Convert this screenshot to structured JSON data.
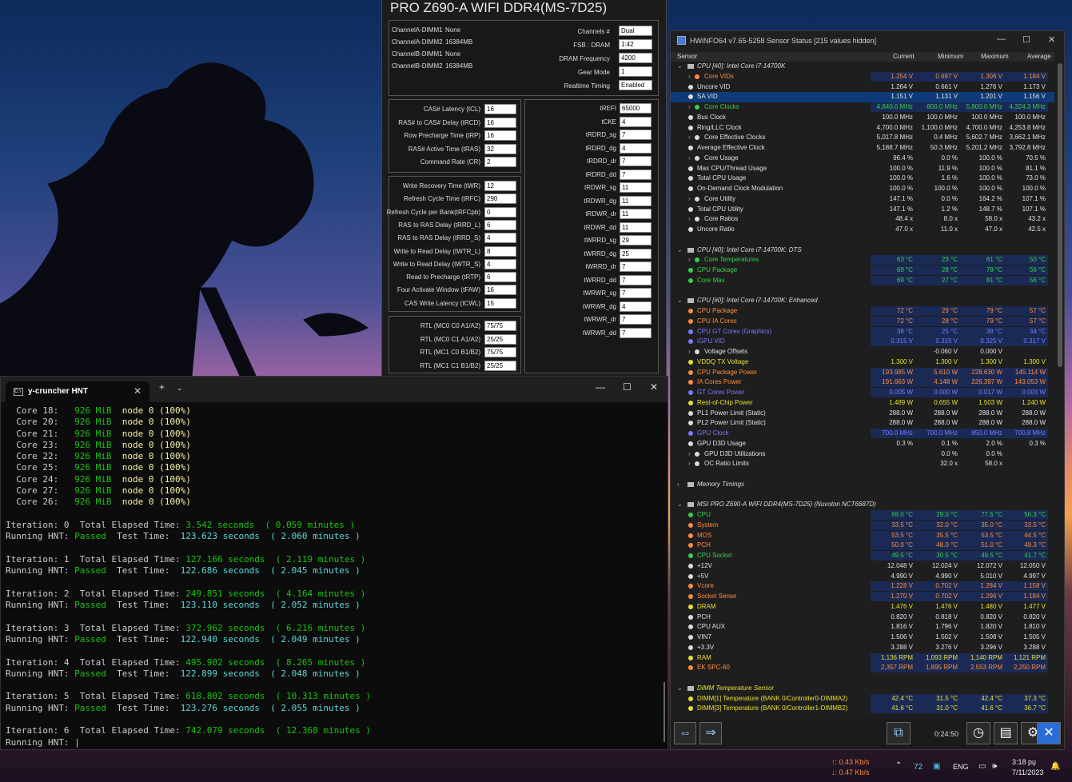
{
  "memory_panel": {
    "title": "PRO Z690-A WIFI DDR4(MS-7D25)",
    "dimms": [
      {
        "label": "ChannelA-DIMM1",
        "value": "None"
      },
      {
        "label": "ChannelA-DIMM2",
        "value": "16384MB"
      },
      {
        "label": "ChannelB-DIMM1",
        "value": "None"
      },
      {
        "label": "ChannelB-DIMM2",
        "value": "16384MB"
      }
    ],
    "summary": [
      {
        "label": "Channels #",
        "value": "Dual"
      },
      {
        "label": "FSB : DRAM",
        "value": "1:42"
      },
      {
        "label": "DRAM Frequency",
        "value": "4200"
      },
      {
        "label": "Gear Mode",
        "value": "1"
      },
      {
        "label": "Realtime Timing",
        "value": "Enabled"
      }
    ],
    "primary": [
      {
        "label": "CAS# Latency (tCL)",
        "value": "16"
      },
      {
        "label": "RAS# to CAS# Delay (tRCD)",
        "value": "16"
      },
      {
        "label": "Row Precharge Time (tRP)",
        "value": "16"
      },
      {
        "label": "RAS# Active Time (tRAS)",
        "value": "32"
      },
      {
        "label": "Command Rate (CR)",
        "value": "2"
      }
    ],
    "secondary": [
      {
        "label": "Write Recovery Time (tWR)",
        "value": "12"
      },
      {
        "label": "Refresh Cycle Time (tRFC)",
        "value": "290"
      },
      {
        "label": "Refresh Cycle per Bank(tRFCpb)",
        "value": "0"
      },
      {
        "label": "RAS to RAS Delay (tRRD_L)",
        "value": "6"
      },
      {
        "label": "RAS to RAS Delay (tRRD_S)",
        "value": "4"
      },
      {
        "label": "Write to Read Delay (tWTR_L)",
        "value": "8"
      },
      {
        "label": "Write to Read Delay (tWTR_S)",
        "value": "4"
      },
      {
        "label": "Read to Precharge (tRTP)",
        "value": "6"
      },
      {
        "label": "Four Activate Window (tFAW)",
        "value": "16"
      },
      {
        "label": "CAS Write Latency (tCWL)",
        "value": "15"
      }
    ],
    "rtl": [
      {
        "label": "RTL (MC0 C0 A1/A2)",
        "value": "75/75"
      },
      {
        "label": "RTL (MC0 C1 A1/A2)",
        "value": "25/25"
      },
      {
        "label": "RTL (MC1 C0 B1/B2)",
        "value": "75/75"
      },
      {
        "label": "RTL (MC1 C1 B1/B2)",
        "value": "25/25"
      }
    ],
    "tertiary": [
      {
        "label": "tREFI",
        "value": "65000"
      },
      {
        "label": "tCKE",
        "value": "4"
      },
      {
        "label": "tRDRD_sg",
        "value": "7"
      },
      {
        "label": "tRDRD_dg",
        "value": "4"
      },
      {
        "label": "tRDRD_dr",
        "value": "7"
      },
      {
        "label": "tRDRD_dd",
        "value": "7"
      },
      {
        "label": "tRDWR_sg",
        "value": "11"
      },
      {
        "label": "tRDWR_dg",
        "value": "11"
      },
      {
        "label": "tRDWR_dr",
        "value": "11"
      },
      {
        "label": "tRDWR_dd",
        "value": "11"
      },
      {
        "label": "tWRRD_sg",
        "value": "29"
      },
      {
        "label": "tWRRD_dg",
        "value": "25"
      },
      {
        "label": "tWRRD_dr",
        "value": "7"
      },
      {
        "label": "tWRRD_dd",
        "value": "7"
      },
      {
        "label": "tWRWR_sg",
        "value": "7"
      },
      {
        "label": "tWRWR_dg",
        "value": "4"
      },
      {
        "label": "tWRWR_dr",
        "value": "7"
      },
      {
        "label": "tWRWR_dd",
        "value": "7"
      }
    ]
  },
  "terminal": {
    "tab_title": "y-cruncher HNT",
    "cores": [
      {
        "core": "18",
        "mem": "926 MiB",
        "node": "node 0 (100%)"
      },
      {
        "core": "20",
        "mem": "926 MiB",
        "node": "node 0 (100%)"
      },
      {
        "core": "21",
        "mem": "926 MiB",
        "node": "node 0 (100%)"
      },
      {
        "core": "23",
        "mem": "926 MiB",
        "node": "node 0 (100%)"
      },
      {
        "core": "22",
        "mem": "926 MiB",
        "node": "node 0 (100%)"
      },
      {
        "core": "25",
        "mem": "926 MiB",
        "node": "node 0 (100%)"
      },
      {
        "core": "24",
        "mem": "926 MiB",
        "node": "node 0 (100%)"
      },
      {
        "core": "27",
        "mem": "926 MiB",
        "node": "node 0 (100%)"
      },
      {
        "core": "26",
        "mem": "926 MiB",
        "node": "node 0 (100%)"
      }
    ],
    "iterations": [
      {
        "n": "0",
        "elapsed": "3.542 seconds",
        "elapsed_min": "( 0.059 minutes )",
        "status": "Passed",
        "test": "123.623 seconds",
        "test_min": "( 2.060 minutes )"
      },
      {
        "n": "1",
        "elapsed": "127.166 seconds",
        "elapsed_min": "( 2.119 minutes )",
        "status": "Passed",
        "test": "122.686 seconds",
        "test_min": "( 2.045 minutes )"
      },
      {
        "n": "2",
        "elapsed": "249.851 seconds",
        "elapsed_min": "( 4.164 minutes )",
        "status": "Passed",
        "test": "123.110 seconds",
        "test_min": "( 2.052 minutes )"
      },
      {
        "n": "3",
        "elapsed": "372.962 seconds",
        "elapsed_min": "( 6.216 minutes )",
        "status": "Passed",
        "test": "122.940 seconds",
        "test_min": "( 2.049 minutes )"
      },
      {
        "n": "4",
        "elapsed": "495.902 seconds",
        "elapsed_min": "( 8.265 minutes )",
        "status": "Passed",
        "test": "122.899 seconds",
        "test_min": "( 2.048 minutes )"
      },
      {
        "n": "5",
        "elapsed": "618.802 seconds",
        "elapsed_min": "( 10.313 minutes )",
        "status": "Passed",
        "test": "123.276 seconds",
        "test_min": "( 2.055 minutes )"
      },
      {
        "n": "6",
        "elapsed": "742.079 seconds",
        "elapsed_min": "( 12.368 minutes )",
        "status": "",
        "test": "",
        "test_min": ""
      }
    ],
    "labels": {
      "core": "Core",
      "iteration": "Iteration:",
      "total": "Total Elapsed Time:",
      "running": "Running HNT:",
      "test": "Test Time:"
    }
  },
  "hwinfo": {
    "title": "HWiNFO64 v7.65-5258 Sensor Status [215 values hidden]",
    "columns": [
      "Sensor",
      "Current",
      "Minimum",
      "Maximum",
      "Average"
    ],
    "rows": [
      {
        "g": true,
        "name": "CPU [#0]: Intel Core i7-14700K"
      },
      {
        "name": "Core VIDs",
        "exp": true,
        "color": "#ff8c3c",
        "v": [
          "1.254 V",
          "0.697 V",
          "1.306 V",
          "1.184 V"
        ],
        "bg": "#1a2a55"
      },
      {
        "name": "Uncore VID",
        "v": [
          "1.264 V",
          "0.661 V",
          "1.276 V",
          "1.173 V"
        ]
      },
      {
        "name": "SA VID",
        "v": [
          "1.151 V",
          "1.131 V",
          "1.201 V",
          "1.156 V"
        ],
        "sel": true
      },
      {
        "name": "Core Clocks",
        "exp": true,
        "color": "#38d04a",
        "v": [
          "4,840.0 MHz",
          "800.0 MHz",
          "5,800.0 MHz",
          "4,324.3 MHz"
        ],
        "bg": "#1a2a55"
      },
      {
        "name": "Bus Clock",
        "v": [
          "100.0 MHz",
          "100.0 MHz",
          "100.0 MHz",
          "100.0 MHz"
        ]
      },
      {
        "name": "Ring/LLC Clock",
        "v": [
          "4,700.0 MHz",
          "1,100.0 MHz",
          "4,700.0 MHz",
          "4,253.8 MHz"
        ]
      },
      {
        "name": "Core Effective Clocks",
        "exp": true,
        "v": [
          "5,017.8 MHz",
          "0.4 MHz",
          "5,602.7 MHz",
          "3,662.1 MHz"
        ]
      },
      {
        "name": "Average Effective Clock",
        "v": [
          "5,188.7 MHz",
          "50.3 MHz",
          "5,201.2 MHz",
          "3,792.8 MHz"
        ]
      },
      {
        "name": "Core Usage",
        "exp": true,
        "v": [
          "96.4 %",
          "0.0 %",
          "100.0 %",
          "70.5 %"
        ]
      },
      {
        "name": "Max CPU/Thread Usage",
        "v": [
          "100.0 %",
          "11.9 %",
          "100.0 %",
          "81.1 %"
        ]
      },
      {
        "name": "Total CPU Usage",
        "v": [
          "100.0 %",
          "1.6 %",
          "100.0 %",
          "73.0 %"
        ]
      },
      {
        "name": "On-Demand Clock Modulation",
        "v": [
          "100.0 %",
          "100.0 %",
          "100.0 %",
          "100.0 %"
        ]
      },
      {
        "name": "Core Utility",
        "exp": true,
        "v": [
          "147.1 %",
          "0.0 %",
          "164.2 %",
          "107.1 %"
        ]
      },
      {
        "name": "Total CPU Utility",
        "v": [
          "147.1 %",
          "1.2 %",
          "148.7 %",
          "107.1 %"
        ]
      },
      {
        "name": "Core Ratios",
        "exp": true,
        "v": [
          "48.4 x",
          "8.0 x",
          "58.0 x",
          "43.2 x"
        ]
      },
      {
        "name": "Uncore Ratio",
        "v": [
          "47.0 x",
          "11.0 x",
          "47.0 x",
          "42.5 x"
        ]
      },
      {
        "blank": true
      },
      {
        "g": true,
        "name": "CPU [#0]: Intel Core i7-14700K: DTS"
      },
      {
        "name": "Core Temperatures",
        "exp": true,
        "color": "#38d04a",
        "v": [
          "63 °C",
          "23 °C",
          "81 °C",
          "50 °C"
        ],
        "bg": "#1a2a55"
      },
      {
        "name": "CPU Package",
        "color": "#38d04a",
        "v": [
          "69 °C",
          "28 °C",
          "78 °C",
          "56 °C"
        ],
        "bg": "#1a2a55"
      },
      {
        "name": "Core Max",
        "color": "#38d04a",
        "v": [
          "69 °C",
          "27 °C",
          "81 °C",
          "56 °C"
        ],
        "bg": "#1a2a55"
      },
      {
        "blank": true
      },
      {
        "g": true,
        "name": "CPU [#0]: Intel Core i7-14700K: Enhanced"
      },
      {
        "name": "CPU Package",
        "color": "#ff8c3c",
        "v": [
          "72 °C",
          "29 °C",
          "79 °C",
          "57 °C"
        ],
        "bg": "#1a2a55"
      },
      {
        "name": "CPU IA Cores",
        "color": "#ff8c3c",
        "v": [
          "72 °C",
          "28 °C",
          "79 °C",
          "57 °C"
        ],
        "bg": "#1a2a55"
      },
      {
        "name": "CPU GT Cores (Graphics)",
        "color": "#7a7aff",
        "v": [
          "38 °C",
          "25 °C",
          "39 °C",
          "34 °C"
        ],
        "bg": "#1a2a55"
      },
      {
        "name": "iGPU VID",
        "color": "#7a7aff",
        "v": [
          "0.315 V",
          "0.315 V",
          "0.325 V",
          "0.317 V"
        ],
        "bg": "#1a2a55"
      },
      {
        "name": "Voltage Offsets",
        "exp": true,
        "v": [
          "",
          "-0.060 V",
          "0.000 V",
          ""
        ]
      },
      {
        "name": "VDDQ TX Voltage",
        "color": "#e8e030",
        "v": [
          "1.300 V",
          "1.300 V",
          "1.300 V",
          "1.300 V"
        ]
      },
      {
        "name": "CPU Package Power",
        "color": "#ff8c3c",
        "v": [
          "193.985 W",
          "5.610 W",
          "228.630 W",
          "145.114 W"
        ],
        "bg": "#1a2a55"
      },
      {
        "name": "IA Cores Power",
        "color": "#ff8c3c",
        "v": [
          "191.663 W",
          "4.148 W",
          "226.397 W",
          "143.053 W"
        ],
        "bg": "#1a2a55"
      },
      {
        "name": "GT Cores Power",
        "color": "#7a7aff",
        "v": [
          "0.005 W",
          "0.000 W",
          "0.017 W",
          "0.003 W"
        ],
        "bg": "#1a2a55"
      },
      {
        "name": "Rest-of-Chip Power",
        "color": "#e8e030",
        "v": [
          "1.489 W",
          "0.655 W",
          "1.503 W",
          "1.240 W"
        ]
      },
      {
        "name": "PL1 Power Limit (Static)",
        "v": [
          "288.0 W",
          "288.0 W",
          "288.0 W",
          "288.0 W"
        ]
      },
      {
        "name": "PL2 Power Limit (Static)",
        "v": [
          "288.0 W",
          "288.0 W",
          "288.0 W",
          "288.0 W"
        ]
      },
      {
        "name": "GPU Clock",
        "color": "#7a7aff",
        "v": [
          "700.0 MHz",
          "700.0 MHz",
          "850.0 MHz",
          "700.8 MHz"
        ],
        "bg": "#1a2a55"
      },
      {
        "name": "GPU D3D Usage",
        "v": [
          "0.3 %",
          "0.1 %",
          "2.0 %",
          "0.3 %"
        ]
      },
      {
        "name": "GPU D3D Utilizations",
        "exp": true,
        "v": [
          "",
          "0.0 %",
          "0.0 %",
          ""
        ]
      },
      {
        "name": "OC Ratio Limits",
        "exp": true,
        "v": [
          "",
          "32.0 x",
          "58.0 x",
          ""
        ]
      },
      {
        "blank": true
      },
      {
        "g": true,
        "collapsed": true,
        "name": "Memory Timings"
      },
      {
        "blank": true
      },
      {
        "g": true,
        "name": "MSI PRO Z690-A WIFI DDR4(MS-7D25) (Nuvoton NCT6687D)"
      },
      {
        "name": "CPU",
        "color": "#38d04a",
        "v": [
          "69.0 °C",
          "29.0 °C",
          "77.5 °C",
          "56.3 °C"
        ],
        "bg": "#1a2a55"
      },
      {
        "name": "System",
        "color": "#ff8c3c",
        "v": [
          "33.5 °C",
          "32.0 °C",
          "35.0 °C",
          "33.5 °C"
        ],
        "bg": "#1a2a55"
      },
      {
        "name": "MOS",
        "color": "#ff8c3c",
        "v": [
          "53.5 °C",
          "35.5 °C",
          "53.5 °C",
          "44.5 °C"
        ],
        "bg": "#1a2a55"
      },
      {
        "name": "PCH",
        "color": "#ff8c3c",
        "v": [
          "50.0 °C",
          "48.0 °C",
          "51.0 °C",
          "49.3 °C"
        ],
        "bg": "#1a2a55"
      },
      {
        "name": "CPU Socket",
        "color": "#38d04a",
        "v": [
          "49.5 °C",
          "30.5 °C",
          "49.5 °C",
          "41.7 °C"
        ],
        "bg": "#1a2a55"
      },
      {
        "name": "+12V",
        "v": [
          "12.048 V",
          "12.024 V",
          "12.072 V",
          "12.050 V"
        ]
      },
      {
        "name": "+5V",
        "v": [
          "4.990 V",
          "4.990 V",
          "5.010 V",
          "4.997 V"
        ]
      },
      {
        "name": "Vcore",
        "color": "#ff8c3c",
        "v": [
          "1.228 V",
          "0.702 V",
          "1.284 V",
          "1.158 V"
        ],
        "bg": "#1a2a55"
      },
      {
        "name": "Socket Sense",
        "color": "#ff8c3c",
        "v": [
          "1.270 V",
          "0.702 V",
          "1.296 V",
          "1.184 V"
        ],
        "bg": "#1a2a55"
      },
      {
        "name": "DRAM",
        "color": "#e8e030",
        "v": [
          "1.476 V",
          "1.476 V",
          "1.480 V",
          "1.477 V"
        ]
      },
      {
        "name": "PCH",
        "v": [
          "0.820 V",
          "0.818 V",
          "0.820 V",
          "0.820 V"
        ]
      },
      {
        "name": "CPU AUX",
        "v": [
          "1.816 V",
          "1.796 V",
          "1.820 V",
          "1.810 V"
        ]
      },
      {
        "name": "VIN7",
        "v": [
          "1.506 V",
          "1.502 V",
          "1.508 V",
          "1.505 V"
        ]
      },
      {
        "name": "+3.3V",
        "v": [
          "3.288 V",
          "3.276 V",
          "3.296 V",
          "3.288 V"
        ]
      },
      {
        "name": "RAM",
        "color": "#e8e030",
        "v": [
          "1,136 RPM",
          "1,093 RPM",
          "1,140 RPM",
          "1,121 RPM"
        ],
        "bg": "#1a2a55"
      },
      {
        "name": "EK SPC-60",
        "color": "#ff8c3c",
        "v": [
          "2,357 RPM",
          "1,895 RPM",
          "2,553 RPM",
          "2,250 RPM"
        ],
        "bg": "#1a2a55"
      },
      {
        "blank": true
      },
      {
        "g": true,
        "name": "DIMM Temperature Sensor",
        "color": "#e8e030"
      },
      {
        "name": "DIMM[1] Temperature (BANK 0/Controller0-DIMMA2)",
        "color": "#e8e030",
        "v": [
          "42.4 °C",
          "31.5 °C",
          "42.4 °C",
          "37.3 °C"
        ],
        "bg": "#1a2a55"
      },
      {
        "name": "DIMM[3] Temperature (BANK 0/Controller1-DIMMB2)",
        "color": "#e8e030",
        "v": [
          "41.6 °C",
          "31.0 °C",
          "41.6 °C",
          "36.7 °C"
        ],
        "bg": "#1a2a55"
      }
    ],
    "elapsed": "0:24:50"
  },
  "taskbar": {
    "net_up": "↑: 0.43 Kb/s",
    "net_down": "↓: 0.47 Kb/s",
    "tray_count": "72",
    "lang": "ENG",
    "time": "3:18 рџ",
    "date": "7/11/2023"
  }
}
